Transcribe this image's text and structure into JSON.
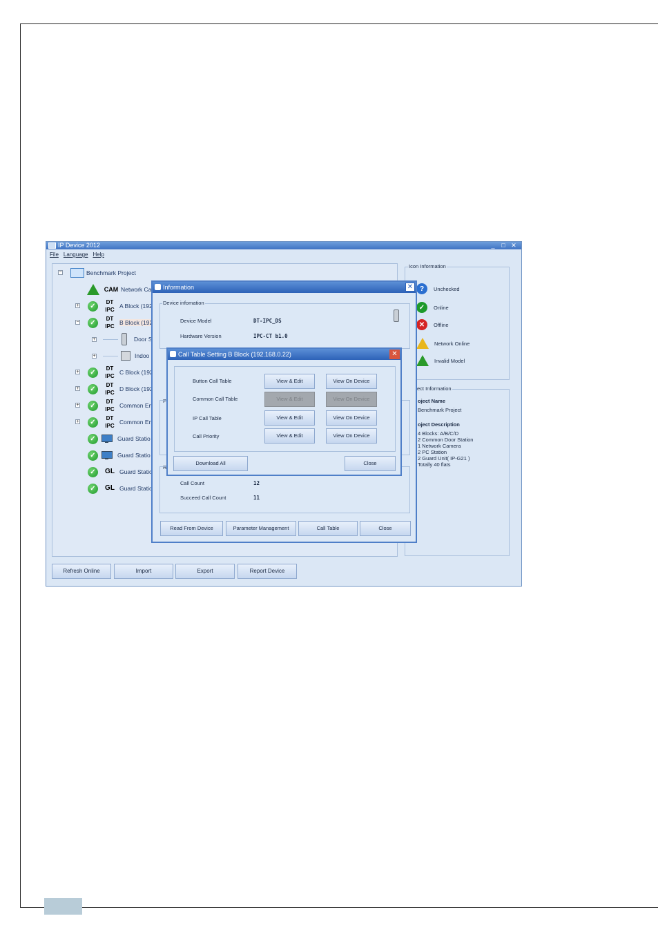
{
  "app": {
    "title": "IP Device 2012",
    "menu": [
      "File",
      "Language",
      "Help"
    ],
    "window_buttons": [
      "_",
      "□",
      "✕"
    ]
  },
  "tree": {
    "root": "Benchmark Project",
    "items": [
      {
        "badge": "CAM",
        "label": "Network Ca",
        "status": "invalid"
      },
      {
        "badge_top": "DT",
        "badge_bottom": "IPC",
        "label": "A Block (192",
        "status": "online"
      },
      {
        "badge_top": "DT",
        "badge_bottom": "IPC",
        "label": "B Block (192",
        "status": "online"
      },
      {
        "label": "Door S",
        "kind": "door"
      },
      {
        "label": "Indoo",
        "kind": "indoor"
      },
      {
        "badge_top": "DT",
        "badge_bottom": "IPC",
        "label": "C Block (192",
        "status": "online"
      },
      {
        "badge_top": "DT",
        "badge_bottom": "IPC",
        "label": "D Block (192",
        "status": "online"
      },
      {
        "badge_top": "DT",
        "badge_bottom": "IPC",
        "label": "Common En",
        "status": "online"
      },
      {
        "badge_top": "DT",
        "badge_bottom": "IPC",
        "label": "Common En",
        "status": "online"
      },
      {
        "badge": "PC",
        "label": "Guard Statio",
        "status": "online"
      },
      {
        "badge": "PC",
        "label": "Guard Statio",
        "status": "online"
      },
      {
        "badge": "GL",
        "label": "Guard Statio",
        "status": "online"
      },
      {
        "badge": "GL",
        "label": "Guard Statio",
        "status": "online"
      }
    ]
  },
  "icon_info": {
    "title": "Icon Information",
    "items": [
      "Unchecked",
      "Online",
      "Offline",
      "Network Online",
      "Invalid Model"
    ]
  },
  "project_info": {
    "title": "ect Information",
    "name_label": "oject Name",
    "name_value": "Benchmark Project",
    "desc_label": "oject Description",
    "desc_lines": [
      "4 Blocks: A/B/C/D",
      "2 Common Door Station",
      "1 Network Camera",
      "2 PC Station",
      "2 Guard Unit( IP-G21 )",
      "Totally 40 flats"
    ]
  },
  "bottom_buttons": [
    "Refresh Online",
    "Import",
    "Export",
    "Report Device"
  ],
  "info_dialog": {
    "title": "Information",
    "group_title": "Device infomation",
    "device_model_label": "Device Model",
    "device_model_value": "DT-IPC_DS",
    "hardware_label": "Hardware Version",
    "hardware_value": "IPC-CT b1.0",
    "p_label": "P",
    "r_label": "R",
    "call_count_label": "Call Count",
    "call_count_value": "12",
    "succeed_label": "Succeed Call Count",
    "succeed_value": "11",
    "buttons": [
      "Read From Device",
      "Parameter Management",
      "Call Table",
      "Close"
    ]
  },
  "call_table_dialog": {
    "title": "Call Table Setting B Block (192.168.0.22)",
    "rows": [
      {
        "label": "Button Call Table",
        "edit": "View & Edit",
        "view": "View On Device",
        "disabled": false
      },
      {
        "label": "Common Call Table",
        "edit": "View & Edit",
        "view": "View On Device",
        "disabled": true
      },
      {
        "label": "IP Call Table",
        "edit": "View & Edit",
        "view": "View On Device",
        "disabled": false
      },
      {
        "label": "Call Priority",
        "edit": "View & Edit",
        "view": "View On Device",
        "disabled": false
      }
    ],
    "download_all": "Download All",
    "close": "Close"
  },
  "colors": {
    "accent": "#2d62b8",
    "online": "#1e9a2b",
    "offline": "#d52424",
    "warning": "#e8b61c"
  }
}
